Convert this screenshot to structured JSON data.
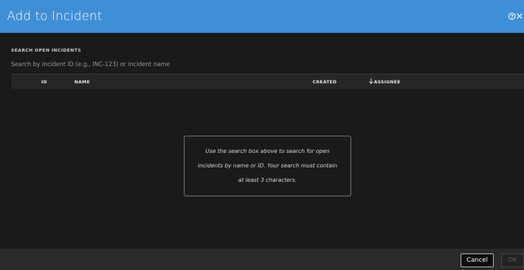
{
  "dialog": {
    "title": "Add to Incident",
    "header_color": "#3f8fd6",
    "icons": [
      "help-icon",
      "close-icon"
    ]
  },
  "search": {
    "label": "SEARCH OPEN INCIDENTS",
    "placeholder": "Search by incident ID (e.g., INC-123) or incident name",
    "value": ""
  },
  "table": {
    "columns": [
      "ID",
      "NAME",
      "CREATED",
      "ASSIGNEE"
    ],
    "sorted_column": "CREATED",
    "sort_direction": "descending",
    "rows": []
  },
  "empty_message": {
    "lines": [
      "Use the search box above to search for open",
      "incidents by name or ID. Your search must contain",
      "at least 3 characters."
    ]
  },
  "footer": {
    "cancel_label": "Cancel",
    "ok_label": "OK"
  }
}
